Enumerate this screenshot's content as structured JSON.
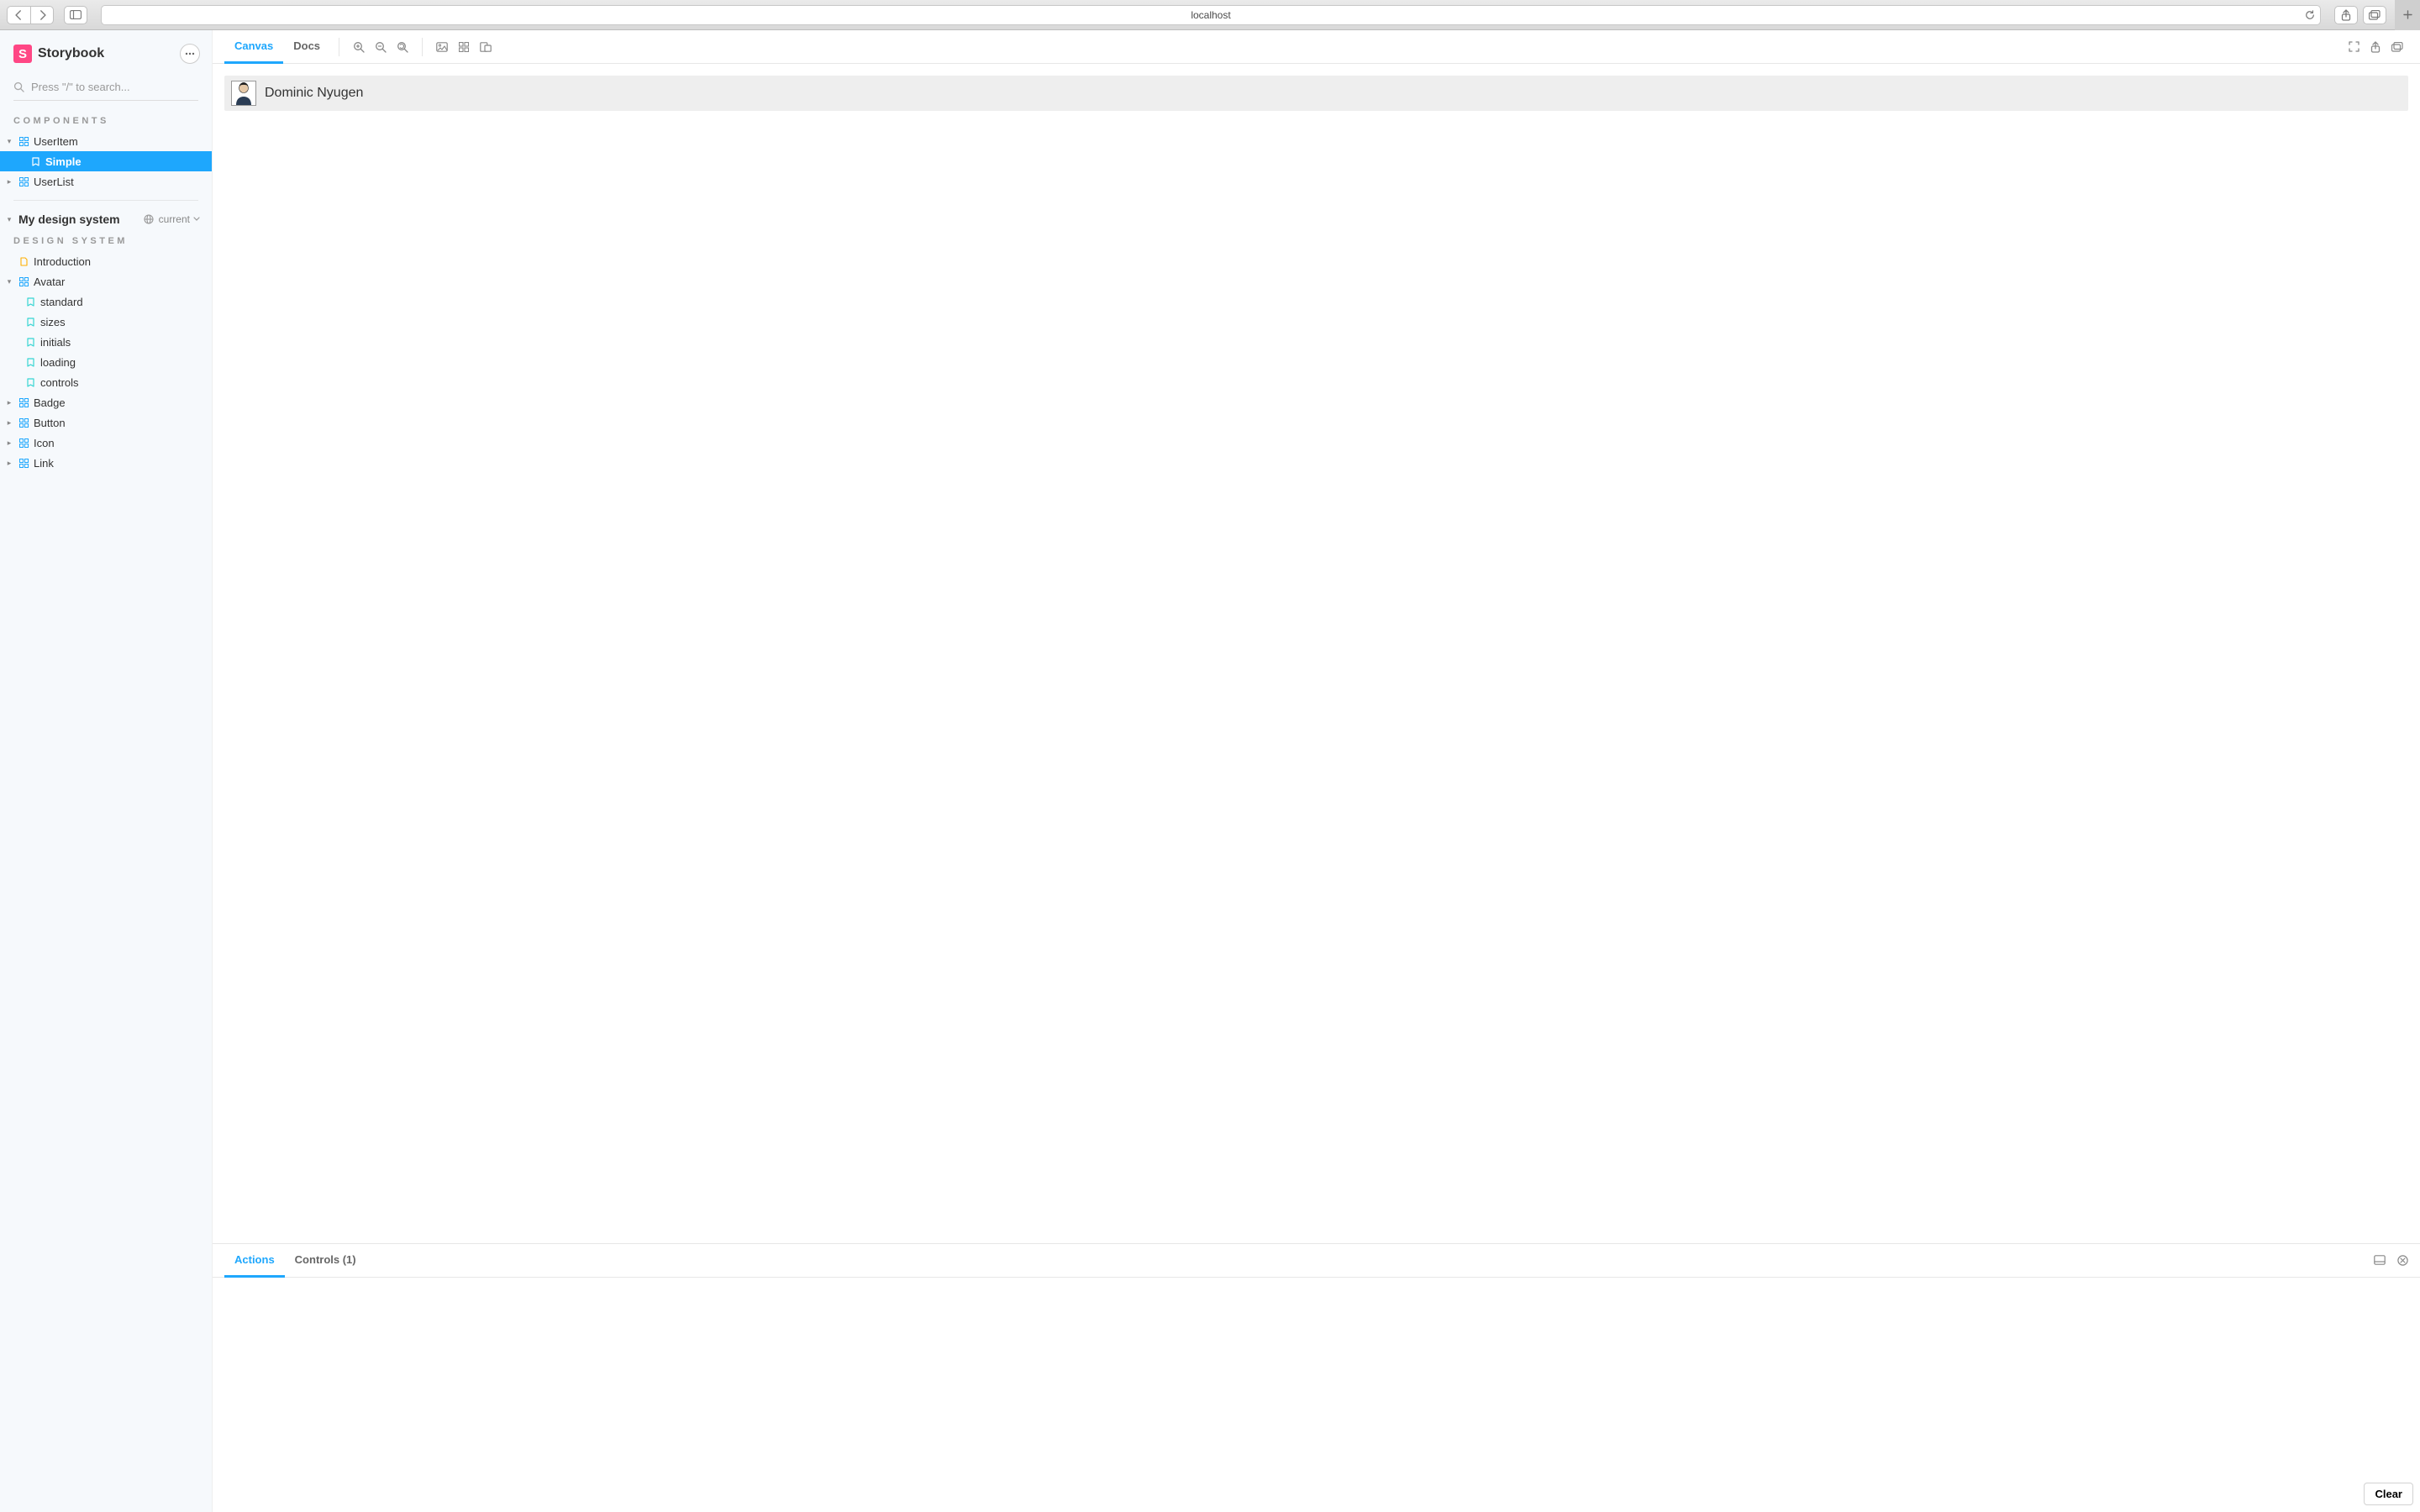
{
  "browser": {
    "url": "localhost"
  },
  "brand": {
    "logo_letter": "S",
    "name": "Storybook"
  },
  "search": {
    "placeholder": "Press \"/\" to search..."
  },
  "sidebar": {
    "components_heading": "COMPONENTS",
    "components": {
      "user_item": "UserItem",
      "user_item_story_simple": "Simple",
      "user_list": "UserList"
    },
    "project_name": "My design system",
    "version_label": "current",
    "design_system_heading": "DESIGN SYSTEM",
    "design_system": {
      "introduction": "Introduction",
      "avatar": "Avatar",
      "avatar_stories": {
        "standard": "standard",
        "sizes": "sizes",
        "initials": "initials",
        "loading": "loading",
        "controls": "controls"
      },
      "badge": "Badge",
      "button": "Button",
      "icon": "Icon",
      "link": "Link"
    }
  },
  "toolbar": {
    "tabs": {
      "canvas": "Canvas",
      "docs": "Docs"
    }
  },
  "preview": {
    "user_name": "Dominic Nyugen"
  },
  "addons": {
    "tabs": {
      "actions": "Actions",
      "controls": "Controls (1)"
    },
    "clear_label": "Clear"
  }
}
